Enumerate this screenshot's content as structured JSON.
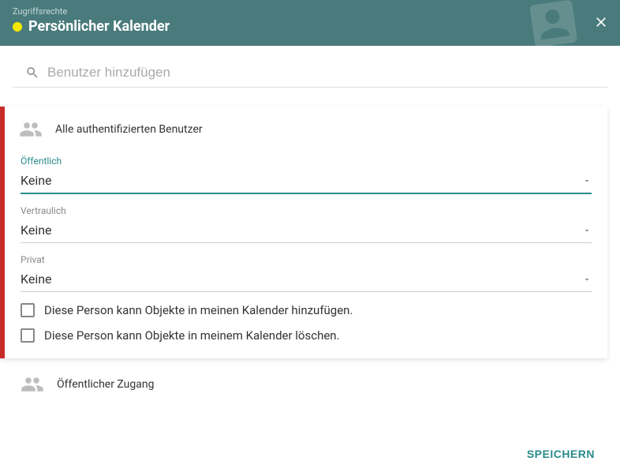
{
  "header": {
    "subtitle": "Zugriffsrechte",
    "title": "Persönlicher Kalender"
  },
  "search": {
    "placeholder": "Benutzer hinzufügen"
  },
  "card": {
    "user_label": "Alle authentifizierten Benutzer",
    "fields": {
      "public": {
        "label": "Öffentlich",
        "value": "Keine"
      },
      "confidential": {
        "label": "Vertraulich",
        "value": "Keine"
      },
      "private": {
        "label": "Privat",
        "value": "Keine"
      }
    },
    "checkboxes": {
      "can_add": "Diese Person kann Objekte in meinen Kalender hinzufügen.",
      "can_delete": "Diese Person kann Objekte in meinem Kalender löschen."
    }
  },
  "public_access": {
    "label": "Öffentlicher Zugang"
  },
  "footer": {
    "save": "SPEICHERN"
  }
}
